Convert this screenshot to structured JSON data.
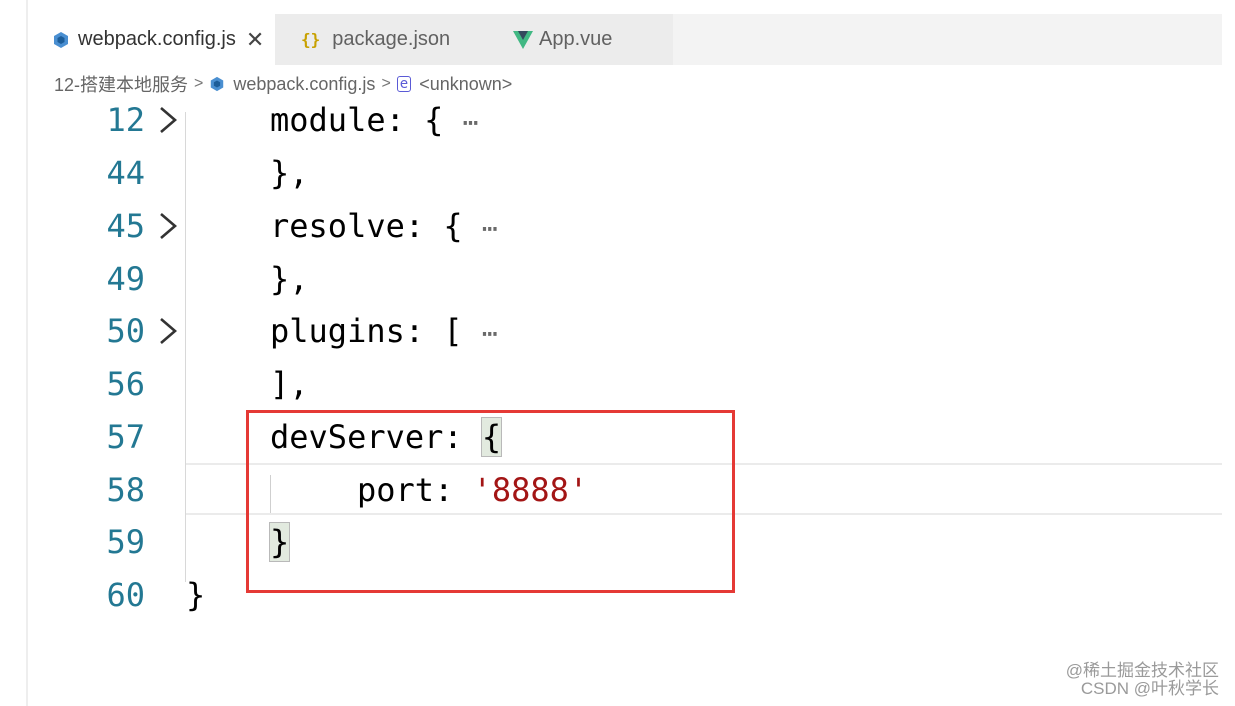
{
  "tabs": [
    {
      "label": "webpack.config.js",
      "icon": "webpack-cube-icon",
      "active": true,
      "close": "✕"
    },
    {
      "label": "package.json",
      "icon": "json-braces-icon",
      "icon_text": "{}"
    },
    {
      "label": "App.vue",
      "icon": "vue-logo-icon"
    }
  ],
  "breadcrumb": {
    "folder": "12-搭建本地服务",
    "file": "webpack.config.js",
    "symbol": "<unknown>",
    "separator": ">"
  },
  "code": [
    {
      "line": "12",
      "text": "module: {",
      "folded": true
    },
    {
      "line": "44",
      "text": "},"
    },
    {
      "line": "45",
      "text": "resolve: {",
      "folded": true
    },
    {
      "line": "49",
      "text": "},"
    },
    {
      "line": "50",
      "text": "plugins: [",
      "folded": true
    },
    {
      "line": "56",
      "text": "],"
    },
    {
      "line": "57",
      "key": "devServer: ",
      "brace": "{"
    },
    {
      "line": "58",
      "key": "port: ",
      "string": "'8888'"
    },
    {
      "line": "59",
      "brace": "}"
    },
    {
      "line": "60",
      "text": "}"
    }
  ],
  "ellipsis": "⋯",
  "watermark": {
    "line1": "@稀土掘金技术社区",
    "line2": "CSDN @叶秋学长"
  },
  "colors": {
    "highlight_box": "#e53935",
    "line_number": "#237893",
    "string": "#a31515"
  }
}
